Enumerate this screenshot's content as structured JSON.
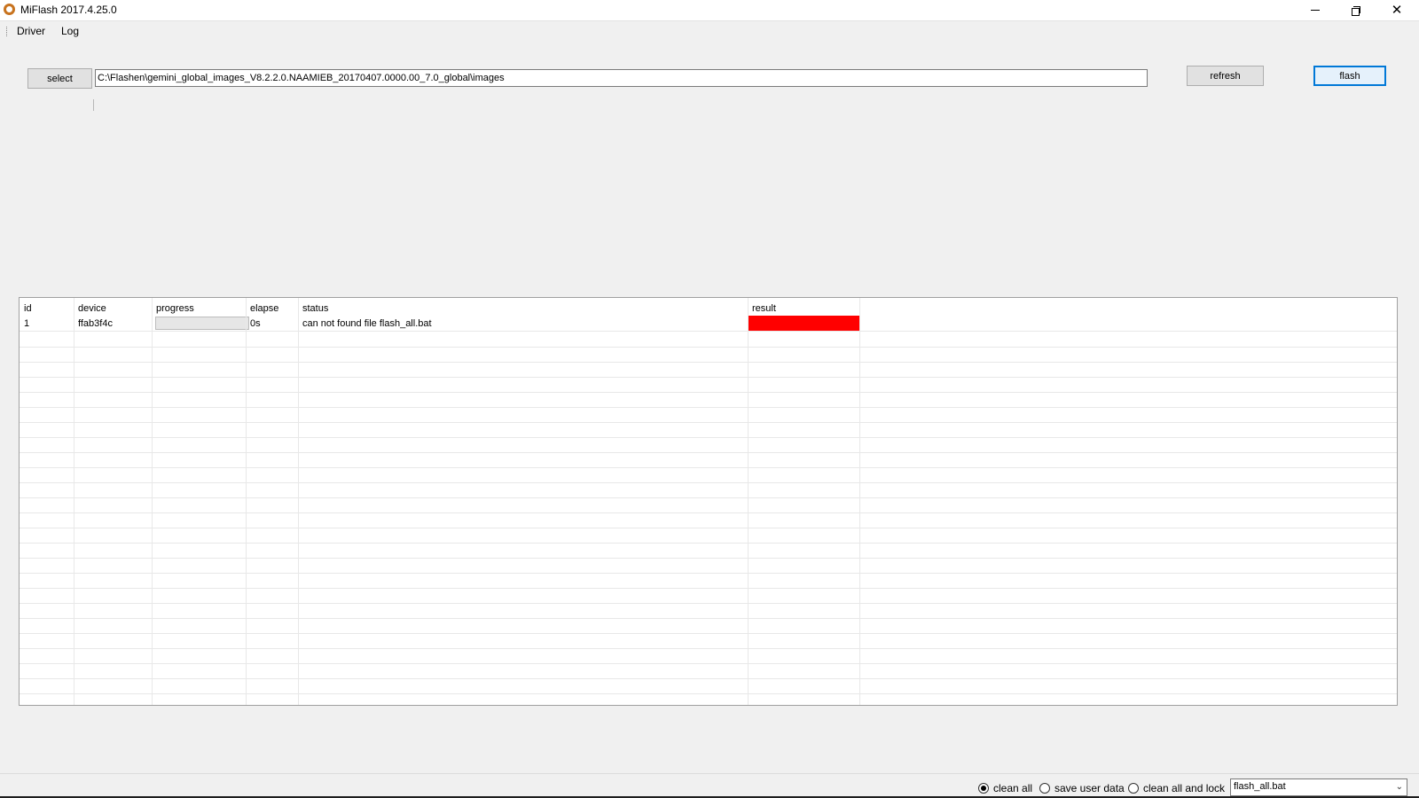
{
  "window": {
    "title": "MiFlash 2017.4.25.0"
  },
  "menu": {
    "items": [
      "Driver",
      "Log"
    ]
  },
  "toolbar": {
    "select_label": "select",
    "path_value": "C:\\Flashen\\gemini_global_images_V8.2.2.0.NAAMIEB_20170407.0000.00_7.0_global\\images",
    "refresh_label": "refresh",
    "flash_label": "flash"
  },
  "grid": {
    "columns": [
      "id",
      "device",
      "progress",
      "elapse",
      "status",
      "result"
    ],
    "rows": [
      {
        "id": "1",
        "device": "ffab3f4c",
        "progress": 0,
        "elapse": "0s",
        "status": "can not found file flash_all.bat",
        "result": "error"
      }
    ]
  },
  "options": {
    "radios": [
      {
        "label": "clean all",
        "checked": true
      },
      {
        "label": "save user data",
        "checked": false
      },
      {
        "label": "clean all and lock",
        "checked": false
      }
    ],
    "script_select": "flash_all.bat"
  },
  "colors": {
    "error": "#ff0000",
    "focus_border": "#0078d7",
    "window_bg": "#f0f0f0"
  }
}
